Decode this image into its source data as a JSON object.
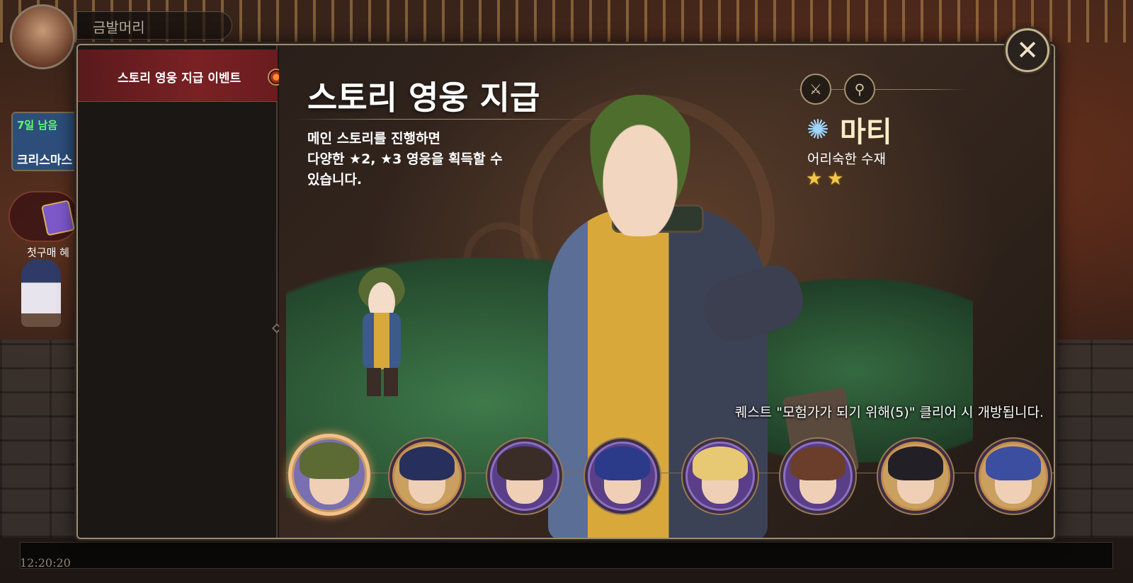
{
  "player": {
    "name": "금발머리",
    "avatar_icon": "player-avatar"
  },
  "side_event": {
    "badge": "7일 남음",
    "label": "크리스마스"
  },
  "side_pack": {
    "label": "첫구매 혜"
  },
  "clock": "12:20:20",
  "popup": {
    "menu": [
      {
        "label": "스토리 영웅 지급 이벤트",
        "selected": true,
        "alert_icon": "alert-dot-icon"
      }
    ],
    "title": "스토리 영웅 지급",
    "description": [
      "메인 스토리를 진행하면",
      "다양한 ★2, ★3 영웅을 획득할 수",
      "있습니다."
    ],
    "hero": {
      "name": "마티",
      "subtitle": "어리숙한 수재",
      "stars": 2,
      "element_icon": "light-element-icon",
      "action_icons": [
        "sword-icon",
        "staff-icon"
      ]
    },
    "quest_note": "퀘스트 \"모험가가 되기 위해(5)\" 클리어 시 개방됩니다.",
    "portraits": [
      {
        "name": "hero-portrait-1",
        "hair": "#5c6a34",
        "frame": "#c49a64",
        "bg": "#7a6fb0",
        "selected": true
      },
      {
        "name": "hero-portrait-2",
        "hair": "#27305c",
        "frame": "#c48a4a",
        "bg": "#c9a060",
        "selected": false
      },
      {
        "name": "hero-portrait-3",
        "hair": "#3a2c26",
        "frame": "#8c6fc2",
        "bg": "#5a3f88",
        "selected": false
      },
      {
        "name": "hero-portrait-4",
        "hair": "#2c3a8a",
        "frame": "#8c6fc2",
        "bg": "#5a3f88",
        "selected": false
      },
      {
        "name": "hero-portrait-5",
        "hair": "#e7c873",
        "frame": "#8c6fc2",
        "bg": "#5a3f88",
        "selected": false
      },
      {
        "name": "hero-portrait-6",
        "hair": "#6a3e2a",
        "frame": "#8c6fc2",
        "bg": "#5a3f88",
        "selected": false
      },
      {
        "name": "hero-portrait-7",
        "hair": "#222026",
        "frame": "#c48a4a",
        "bg": "#c9a060",
        "selected": false
      },
      {
        "name": "hero-portrait-8",
        "hair": "#3c4ea0",
        "frame": "#c48a4a",
        "bg": "#c9a060",
        "selected": false
      }
    ],
    "close_icon": "close-icon"
  },
  "colors": {
    "accent": "#7a2124",
    "frame": "#9c8d74",
    "star": "#f2c64a",
    "name_gold": "#fbefc7"
  }
}
